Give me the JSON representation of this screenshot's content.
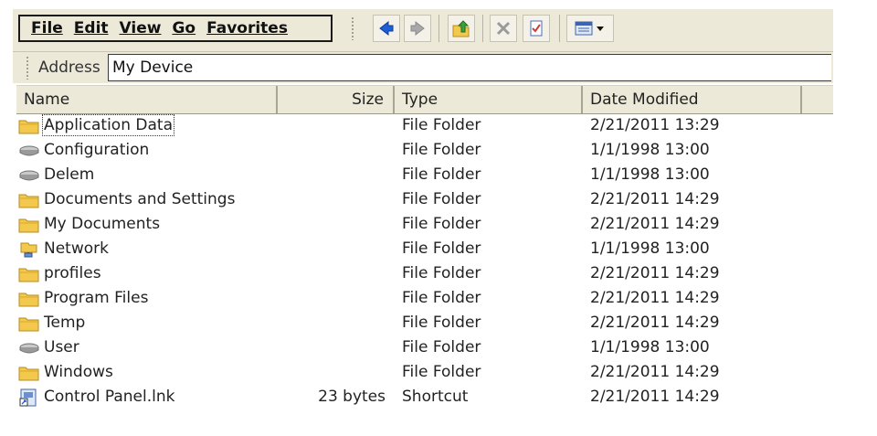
{
  "menu": [
    "File",
    "Edit",
    "View",
    "Go",
    "Favorites"
  ],
  "address": {
    "label": "Address",
    "value": "My Device"
  },
  "columns": {
    "name": "Name",
    "size": "Size",
    "type": "Type",
    "date": "Date Modified"
  },
  "files": [
    {
      "name": "Application Data",
      "size": "",
      "type": "File Folder",
      "date": "2/21/2011 13:29",
      "icon": "folder-icon"
    },
    {
      "name": "Configuration",
      "size": "",
      "type": "File Folder",
      "date": "1/1/1998 13:00",
      "icon": "drive-icon"
    },
    {
      "name": "Delem",
      "size": "",
      "type": "File Folder",
      "date": "1/1/1998 13:00",
      "icon": "drive-icon"
    },
    {
      "name": "Documents and Settings",
      "size": "",
      "type": "File Folder",
      "date": "2/21/2011 14:29",
      "icon": "folder-icon"
    },
    {
      "name": "My Documents",
      "size": "",
      "type": "File Folder",
      "date": "2/21/2011 14:29",
      "icon": "folder-icon"
    },
    {
      "name": "Network",
      "size": "",
      "type": "File Folder",
      "date": "1/1/1998 13:00",
      "icon": "network-icon"
    },
    {
      "name": "profiles",
      "size": "",
      "type": "File Folder",
      "date": "2/21/2011 14:29",
      "icon": "folder-icon"
    },
    {
      "name": "Program Files",
      "size": "",
      "type": "File Folder",
      "date": "2/21/2011 14:29",
      "icon": "folder-icon"
    },
    {
      "name": "Temp",
      "size": "",
      "type": "File Folder",
      "date": "2/21/2011 14:29",
      "icon": "folder-icon"
    },
    {
      "name": "User",
      "size": "",
      "type": "File Folder",
      "date": "1/1/1998 13:00",
      "icon": "drive-icon"
    },
    {
      "name": "Windows",
      "size": "",
      "type": "File Folder",
      "date": "2/21/2011 14:29",
      "icon": "folder-icon"
    },
    {
      "name": "Control Panel.lnk",
      "size": "23 bytes",
      "type": "Shortcut",
      "date": "2/21/2011 14:29",
      "icon": "shortcut-icon"
    }
  ],
  "colors": {
    "chrome": "#ece9d8",
    "back_arrow": "#1f5fd6",
    "folder": "#f2c94c"
  }
}
